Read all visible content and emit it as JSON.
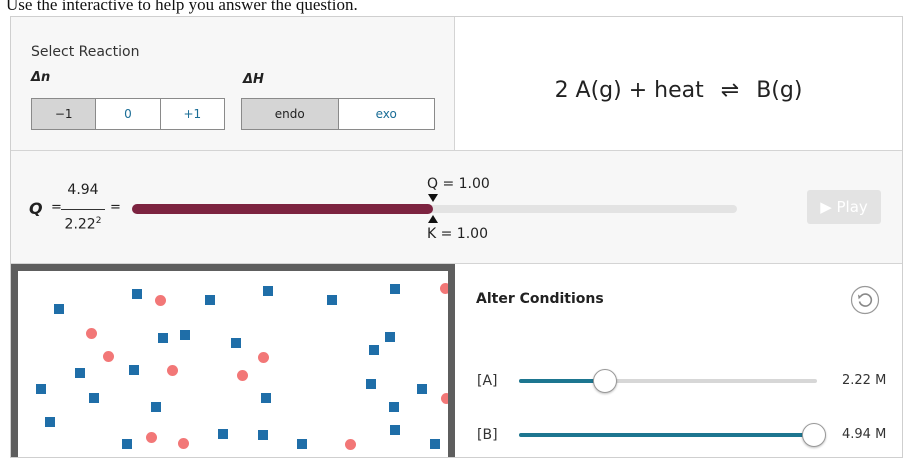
{
  "instructions": "Use the interactive to help you answer the question.",
  "reaction_selector": {
    "title": "Select Reaction",
    "delta_n": {
      "label": "Δn",
      "options": [
        "−1",
        "0",
        "+1"
      ],
      "selected": "−1"
    },
    "delta_h": {
      "label": "ΔH",
      "options": [
        "endo",
        "exo"
      ],
      "selected": "endo"
    }
  },
  "equation": {
    "lhs": "2 A(g) + heat",
    "arrow": "⇌",
    "rhs": "B(g)"
  },
  "quotient": {
    "q_symbol": "Q",
    "equals": "=",
    "numerator": "4.94",
    "denominator": "2.22",
    "exponent": "2",
    "q_marker": "Q = 1.00",
    "k_marker": "K = 1.00",
    "q_fraction_filled": 0.5
  },
  "play_button": {
    "icon": "play-icon",
    "label": "▶ Play"
  },
  "conditions": {
    "title": "Alter Conditions",
    "reset_icon": "reset-icon",
    "sliders": [
      {
        "label": "[A]",
        "value_text": "2.22 M",
        "fraction": 0.29
      },
      {
        "label": "[B]",
        "value_text": "4.94 M",
        "fraction": 0.99
      }
    ]
  },
  "colors": {
    "q_bar": "#7c2340",
    "slider_fill": "#1d7690",
    "particle_a": "#1f6ea8",
    "particle_b": "#f27777",
    "box_border": "#5e5e5e"
  },
  "particles": {
    "a_count": 31,
    "b_count": 14
  }
}
